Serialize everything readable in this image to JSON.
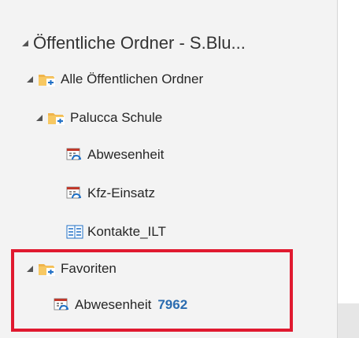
{
  "tree": {
    "root": {
      "label": "Öffentliche Ordner - S.Blu..."
    },
    "all_public_folders": {
      "label": "Alle Öffentlichen Ordner"
    },
    "palucca_schule": {
      "label": "Palucca Schule"
    },
    "abwesenheit": {
      "label": "Abwesenheit"
    },
    "kfz_einsatz": {
      "label": "Kfz-Einsatz"
    },
    "kontakte_ilt": {
      "label": "Kontakte_ILT"
    },
    "favoriten": {
      "label": "Favoriten"
    },
    "favorit_abwesenheit": {
      "label": "Abwesenheit",
      "count": "7962"
    }
  },
  "colors": {
    "highlight": "#e0192f",
    "count": "#2b6cb0",
    "folder": "#f0b44a",
    "calendar_icon": "#c0392b",
    "sync_icon": "#1f6fc5"
  }
}
